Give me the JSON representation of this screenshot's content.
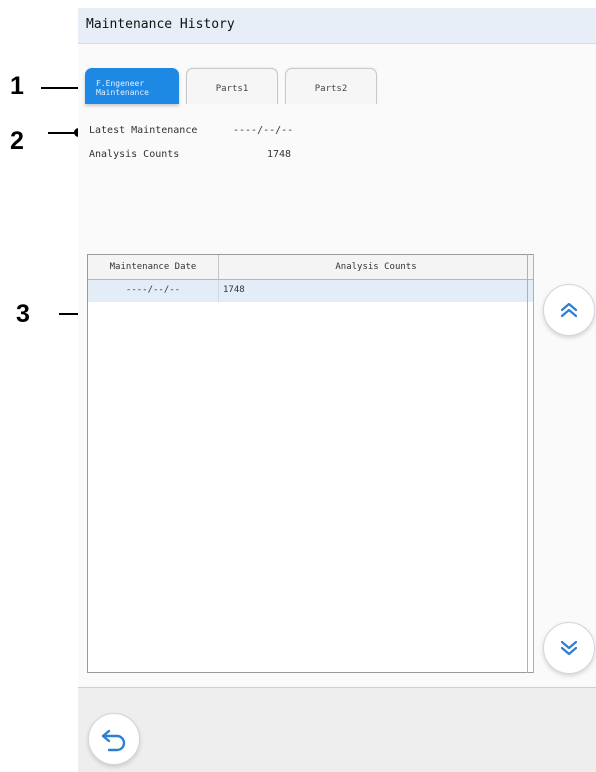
{
  "window": {
    "title": "Maintenance History"
  },
  "callouts": {
    "one": "1",
    "two": "2",
    "three": "3"
  },
  "tabs": [
    {
      "label": "F.Engeneer\nMaintenance",
      "active": true
    },
    {
      "label": "Parts1",
      "active": false
    },
    {
      "label": "Parts2",
      "active": false
    }
  ],
  "info": {
    "latest_label": "Latest Maintenance",
    "latest_value": "----/--/--",
    "counts_label": "Analysis Counts",
    "counts_value": "1748"
  },
  "table": {
    "headers": [
      "Maintenance Date",
      "Analysis Counts"
    ],
    "rows": [
      [
        "----/--/--",
        "1748"
      ]
    ]
  },
  "icons": {
    "scroll_up": "double-chevron-up-icon",
    "scroll_down": "double-chevron-down-icon",
    "back": "undo-arrow-icon"
  },
  "colors": {
    "accent": "#1e88e5",
    "title_bar": "#e8eef7",
    "selected_row": "#e3edf7"
  }
}
